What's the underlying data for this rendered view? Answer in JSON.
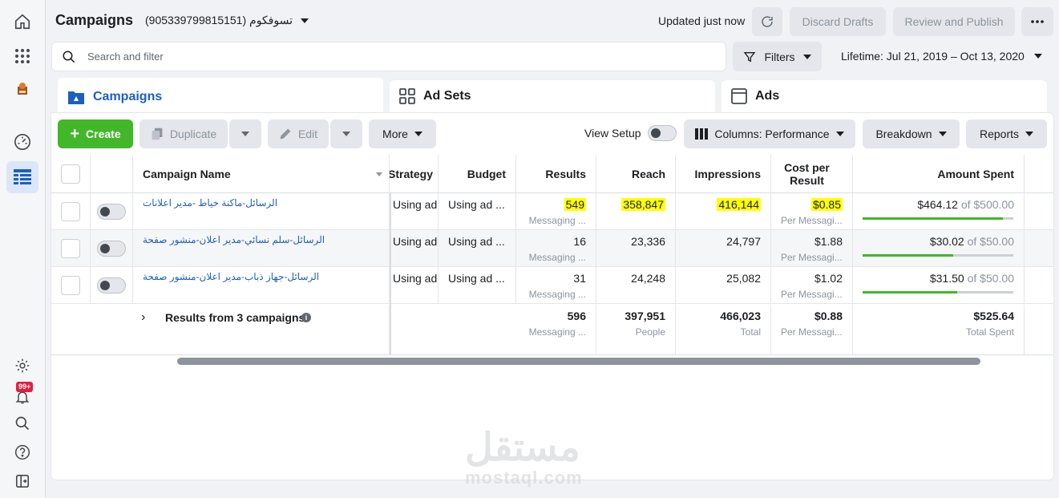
{
  "header": {
    "title": "Campaigns",
    "account": "تسوفكوم (905339799815151)",
    "updated": "Updated just now",
    "discard": "Discard Drafts",
    "review": "Review and Publish",
    "more_icon": "more-horizontal-icon"
  },
  "search": {
    "placeholder": "Search and filter",
    "filters": "Filters",
    "lifetime": "Lifetime: Jul 21, 2019 – Oct 13, 2020"
  },
  "tabs": [
    {
      "label": "Campaigns"
    },
    {
      "label": "Ad Sets"
    },
    {
      "label": "Ads"
    }
  ],
  "toolbar": {
    "create": "Create",
    "duplicate": "Duplicate",
    "edit": "Edit",
    "more": "More",
    "view_setup": "View Setup",
    "columns": "Columns: Performance",
    "breakdown": "Breakdown",
    "reports": "Reports"
  },
  "columns": {
    "name": "Campaign Name",
    "strategy": "Strategy",
    "budget": "Budget",
    "results": "Results",
    "reach": "Reach",
    "impressions": "Impressions",
    "cpr_line1": "Cost per",
    "cpr_line2": "Result",
    "spent": "Amount Spent"
  },
  "rows": [
    {
      "name": "الرسائل-ماكنة خياط -مدير اعلانات",
      "strategy": "Using ad s...",
      "budget": "Using ad ...",
      "results": "549",
      "results_sub": "Messaging ...",
      "reach": "358,847",
      "impressions": "416,144",
      "cpr": "$0.85",
      "cpr_sub": "Per Messagi...",
      "spent": "$464.12",
      "budget_cap": "of $500.00",
      "progress": 0.93,
      "highlight": true
    },
    {
      "name": "الرسائل-سلم نسائي-مدير اعلان-منشور صفحة",
      "strategy": "Using ad s...",
      "budget": "Using ad ...",
      "results": "16",
      "results_sub": "Messaging ...",
      "reach": "23,336",
      "impressions": "24,797",
      "cpr": "$1.88",
      "cpr_sub": "Per Messagi...",
      "spent": "$30.02",
      "budget_cap": "of $50.00",
      "progress": 0.6,
      "highlight": false
    },
    {
      "name": "الرسائل-جهاز ذباب-مدير اعلان-منشور صفحة",
      "strategy": "Using ad s...",
      "budget": "Using ad ...",
      "results": "31",
      "results_sub": "Messaging ...",
      "reach": "24,248",
      "impressions": "25,082",
      "cpr": "$1.02",
      "cpr_sub": "Per Messagi...",
      "spent": "$31.50",
      "budget_cap": "of $50.00",
      "progress": 0.63,
      "highlight": false
    }
  ],
  "totals": {
    "label": "Results from 3 campaigns",
    "results": "596",
    "results_sub": "Messaging ...",
    "reach": "397,951",
    "reach_sub": "People",
    "impressions": "466,023",
    "impressions_sub": "Total",
    "cpr": "$0.88",
    "cpr_sub": "Per Messagi...",
    "spent": "$525.64",
    "spent_sub": "Total Spent"
  },
  "watermark": {
    "arabic": "مستقل",
    "latin": "mostaql.com"
  },
  "sidebar": {
    "notifications_badge": "99+"
  },
  "colors": {
    "accent": "#1d5fbf",
    "create": "#42b72a",
    "highlight": "#ffff00",
    "badge": "#e41e3f"
  }
}
